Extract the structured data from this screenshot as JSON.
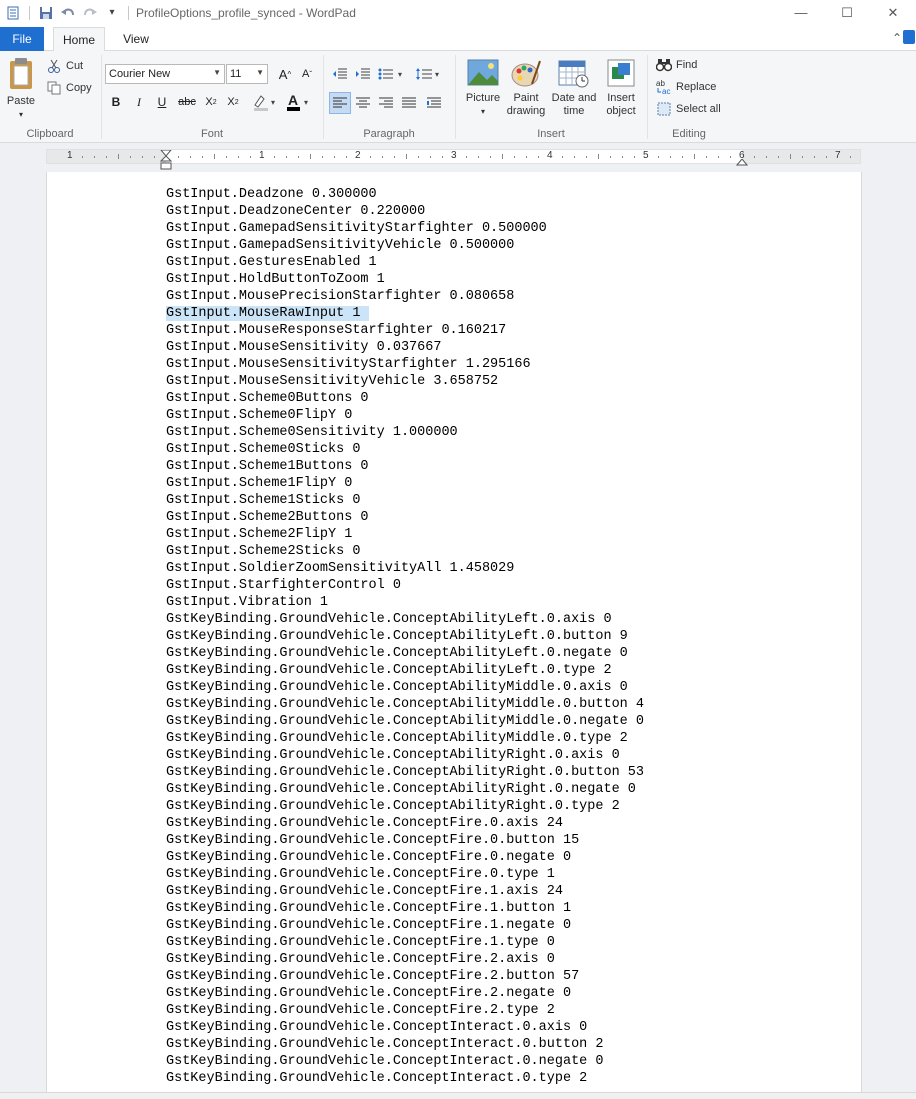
{
  "window": {
    "title": "ProfileOptions_profile_synced - WordPad",
    "controls": [
      "minimize-icon",
      "maximize-icon",
      "close-icon"
    ]
  },
  "tabs": {
    "file": "File",
    "home": "Home",
    "view": "View"
  },
  "ribbon": {
    "clipboard": {
      "label": "Clipboard",
      "paste": "Paste",
      "cut": "Cut",
      "copy": "Copy"
    },
    "font": {
      "label": "Font",
      "family": "Courier New",
      "size": "11"
    },
    "paragraph": {
      "label": "Paragraph"
    },
    "insert": {
      "label": "Insert",
      "picture": "Picture",
      "paint_line1": "Paint",
      "paint_line2": "drawing",
      "date_line1": "Date and",
      "date_line2": "time",
      "object_line1": "Insert",
      "object_line2": "object"
    },
    "editing": {
      "label": "Editing",
      "find": "Find",
      "replace": "Replace",
      "select_all": "Select all"
    }
  },
  "ruler": {
    "numbers": [
      "1",
      "1",
      "2",
      "3",
      "4",
      "5",
      "6",
      "7"
    ]
  },
  "document": {
    "selected_index": 7,
    "lines": [
      "GstInput.Deadzone 0.300000",
      "GstInput.DeadzoneCenter 0.220000",
      "GstInput.GamepadSensitivityStarfighter 0.500000",
      "GstInput.GamepadSensitivityVehicle 0.500000",
      "GstInput.GesturesEnabled 1",
      "GstInput.HoldButtonToZoom 1",
      "GstInput.MousePrecisionStarfighter 0.080658",
      "GstInput.MouseRawInput 1 ",
      "GstInput.MouseResponseStarfighter 0.160217",
      "GstInput.MouseSensitivity 0.037667",
      "GstInput.MouseSensitivityStarfighter 1.295166",
      "GstInput.MouseSensitivityVehicle 3.658752",
      "GstInput.Scheme0Buttons 0",
      "GstInput.Scheme0FlipY 0",
      "GstInput.Scheme0Sensitivity 1.000000",
      "GstInput.Scheme0Sticks 0",
      "GstInput.Scheme1Buttons 0",
      "GstInput.Scheme1FlipY 0",
      "GstInput.Scheme1Sticks 0",
      "GstInput.Scheme2Buttons 0",
      "GstInput.Scheme2FlipY 1",
      "GstInput.Scheme2Sticks 0",
      "GstInput.SoldierZoomSensitivityAll 1.458029",
      "GstInput.StarfighterControl 0",
      "GstInput.Vibration 1",
      "GstKeyBinding.GroundVehicle.ConceptAbilityLeft.0.axis 0",
      "GstKeyBinding.GroundVehicle.ConceptAbilityLeft.0.button 9",
      "GstKeyBinding.GroundVehicle.ConceptAbilityLeft.0.negate 0",
      "GstKeyBinding.GroundVehicle.ConceptAbilityLeft.0.type 2",
      "GstKeyBinding.GroundVehicle.ConceptAbilityMiddle.0.axis 0",
      "GstKeyBinding.GroundVehicle.ConceptAbilityMiddle.0.button 4",
      "GstKeyBinding.GroundVehicle.ConceptAbilityMiddle.0.negate 0",
      "GstKeyBinding.GroundVehicle.ConceptAbilityMiddle.0.type 2",
      "GstKeyBinding.GroundVehicle.ConceptAbilityRight.0.axis 0",
      "GstKeyBinding.GroundVehicle.ConceptAbilityRight.0.button 53",
      "GstKeyBinding.GroundVehicle.ConceptAbilityRight.0.negate 0",
      "GstKeyBinding.GroundVehicle.ConceptAbilityRight.0.type 2",
      "GstKeyBinding.GroundVehicle.ConceptFire.0.axis 24",
      "GstKeyBinding.GroundVehicle.ConceptFire.0.button 15",
      "GstKeyBinding.GroundVehicle.ConceptFire.0.negate 0",
      "GstKeyBinding.GroundVehicle.ConceptFire.0.type 1",
      "GstKeyBinding.GroundVehicle.ConceptFire.1.axis 24",
      "GstKeyBinding.GroundVehicle.ConceptFire.1.button 1",
      "GstKeyBinding.GroundVehicle.ConceptFire.1.negate 0",
      "GstKeyBinding.GroundVehicle.ConceptFire.1.type 0",
      "GstKeyBinding.GroundVehicle.ConceptFire.2.axis 0",
      "GstKeyBinding.GroundVehicle.ConceptFire.2.button 57",
      "GstKeyBinding.GroundVehicle.ConceptFire.2.negate 0",
      "GstKeyBinding.GroundVehicle.ConceptFire.2.type 2",
      "GstKeyBinding.GroundVehicle.ConceptInteract.0.axis 0",
      "GstKeyBinding.GroundVehicle.ConceptInteract.0.button 2",
      "GstKeyBinding.GroundVehicle.ConceptInteract.0.negate 0",
      "GstKeyBinding.GroundVehicle.ConceptInteract.0.type 2"
    ]
  },
  "colors": {
    "accent": "#1e6fd0",
    "selection": "#cce4f7",
    "ribbon_bg": "#f5f6f7"
  }
}
